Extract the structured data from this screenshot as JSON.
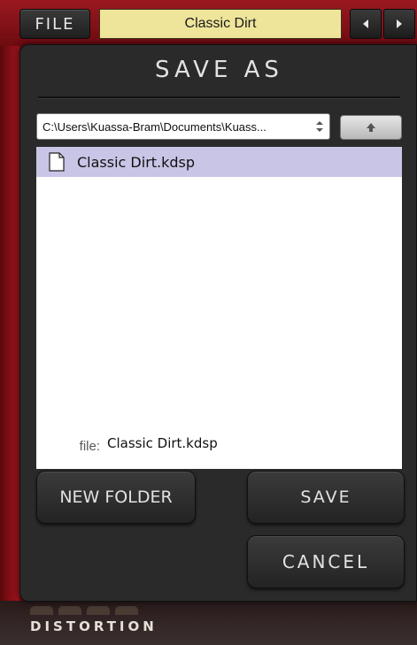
{
  "topbar": {
    "file_label": "FILE",
    "preset_name": "Classic Dirt",
    "prev_label": "◀",
    "next_label": "▶"
  },
  "dialog": {
    "title": "SAVE AS",
    "path": "C:\\Users\\Kuassa-Bram\\Documents\\Kuass...",
    "files": [
      {
        "name": "Classic Dirt.kdsp",
        "selected": true
      }
    ],
    "file_label": "file:",
    "filename_value": "Classic Dirt.kdsp",
    "new_folder_label": "NEW FOLDER",
    "save_label": "SAVE",
    "cancel_label": "CANCEL"
  },
  "brand": {
    "subtitle": "DISTORTION"
  },
  "colors": {
    "accent_red": "#8e1118",
    "preset_field": "#efe59a",
    "selection": "#c9c5e6"
  }
}
